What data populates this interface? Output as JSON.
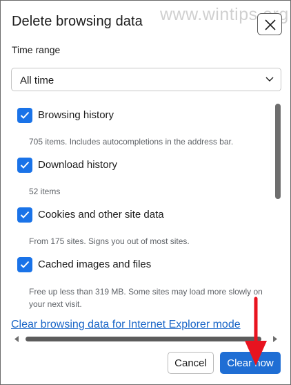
{
  "dialog": {
    "title": "Delete browsing data",
    "watermark": "www.wintips.org",
    "close_icon": "close-icon"
  },
  "time_range": {
    "label": "Time range",
    "selected": "All time",
    "chevron_icon": "chevron-down-icon"
  },
  "items": [
    {
      "label": "Browsing history",
      "checked": true,
      "description": "705 items. Includes autocompletions in the address bar."
    },
    {
      "label": "Download history",
      "checked": true,
      "description": "52 items"
    },
    {
      "label": "Cookies and other site data",
      "checked": true,
      "description": "From 175 sites. Signs you out of most sites."
    },
    {
      "label": "Cached images and files",
      "checked": true,
      "description": "Free up less than 319 MB. Some sites may load more slowly on your next visit."
    }
  ],
  "ie_link": "Clear browsing data for Internet Explorer mode",
  "buttons": {
    "cancel": "Cancel",
    "clear": "Clear now"
  },
  "colors": {
    "accent": "#1a73e8",
    "primary_button": "#1f6ed4",
    "link": "#1a66c7",
    "annotation": "#e8131f"
  }
}
